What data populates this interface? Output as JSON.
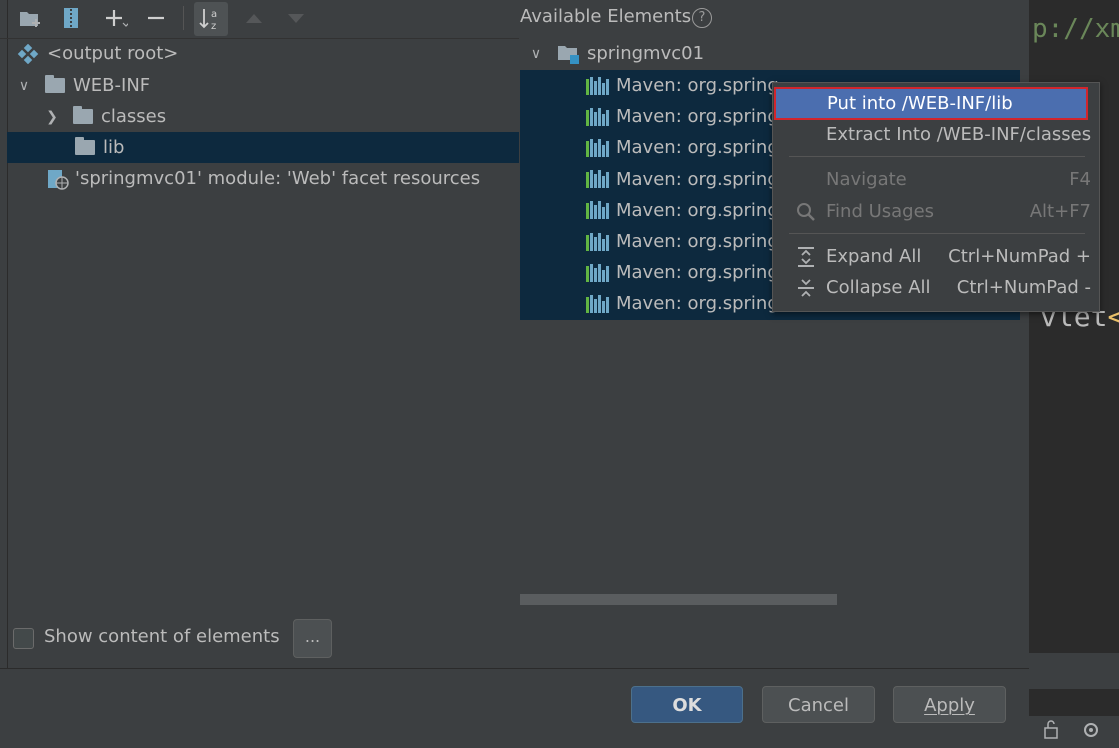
{
  "editor": {
    "code_line1": "p://xm",
    "code_line2_text": "vlet",
    "code_line2_tag": "<"
  },
  "toolbar": {
    "icons": [
      "new-folder-icon",
      "archive-icon",
      "add-icon",
      "remove-icon",
      "sort-alphabetically-icon",
      "move-up-icon",
      "move-down-icon"
    ]
  },
  "left_tree": {
    "items": [
      {
        "label": "<output root>",
        "icon": "output-root-icon"
      },
      {
        "label": "WEB-INF",
        "icon": "folder-icon",
        "expanded": true
      },
      {
        "label": "classes",
        "icon": "folder-icon",
        "expanded": false
      },
      {
        "label": "lib",
        "icon": "folder-icon",
        "selected": true
      },
      {
        "label": "'springmvc01' module: 'Web' facet resources",
        "icon": "web-facet-icon"
      }
    ]
  },
  "available": {
    "title": "Available Elements",
    "module": "springmvc01",
    "libraries": [
      "Maven: org.spring",
      "Maven: org.spring",
      "Maven: org.spring",
      "Maven: org.spring",
      "Maven: org.spring",
      "Maven: org.spring",
      "Maven: org.spring",
      "Maven: org.spring"
    ]
  },
  "context_menu": {
    "put_into": "Put into /WEB-INF/lib",
    "extract_into": "Extract Into /WEB-INF/classes",
    "navigate": "Navigate",
    "navigate_shortcut": "F4",
    "find_usages": "Find Usages",
    "find_usages_shortcut": "Alt+F7",
    "expand_all": "Expand All",
    "expand_all_shortcut": "Ctrl+NumPad +",
    "collapse_all": "Collapse All",
    "collapse_all_shortcut": "Ctrl+NumPad -"
  },
  "options": {
    "show_content_label": "Show content of elements",
    "show_content_checked": false,
    "ellipsis_label": "..."
  },
  "buttons": {
    "ok": "OK",
    "cancel": "Cancel",
    "apply": "Apply"
  }
}
